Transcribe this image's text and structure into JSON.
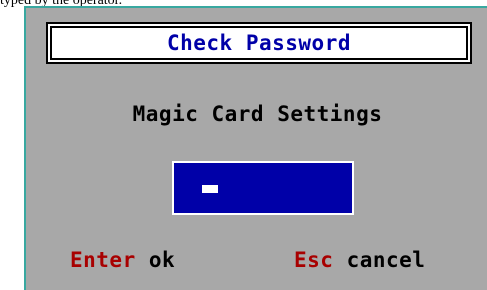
{
  "top_text": "typed by the operator.",
  "dialog": {
    "title": "Check Password",
    "subtitle": "Magic Card Settings",
    "password_value": "",
    "hints": [
      {
        "key": "Enter",
        "action": "ok"
      },
      {
        "key": "Esc",
        "action": "cancel"
      }
    ]
  },
  "colors": {
    "dialog_bg": "#a8a8a8",
    "title_text": "#0000a8",
    "field_bg": "#0000a8",
    "key_text": "#a80000",
    "accent_border": "#38a8a0"
  },
  "icons": {
    "text_cursor": "text-cursor-icon"
  }
}
